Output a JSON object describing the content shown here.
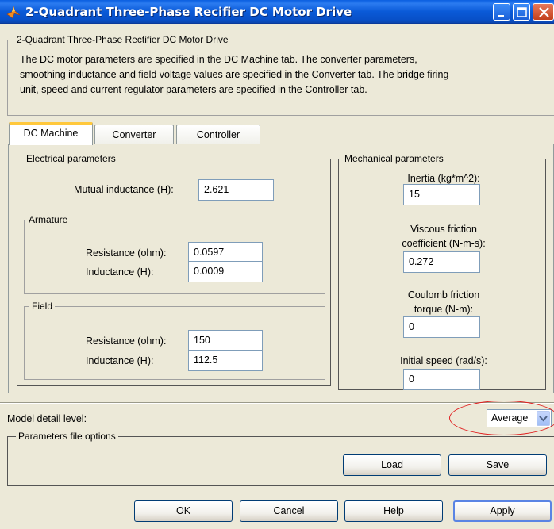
{
  "window": {
    "title": "2-Quadrant Three-Phase Recifier DC Motor Drive",
    "icon": "matlab-logo-icon"
  },
  "description": {
    "group_title": "2-Quadrant Three-Phase Rectifier DC Motor Drive",
    "lines": [
      "The DC motor parameters are specified in the DC Machine tab. The converter parameters,",
      "smoothing inductance and field voltage values are specified in the Converter tab. The bridge firing",
      "unit, speed and current regulator parameters are specified in the Controller tab."
    ]
  },
  "tabs": [
    {
      "label": "DC Machine",
      "active": true
    },
    {
      "label": "Converter",
      "active": false
    },
    {
      "label": "Controller",
      "active": false
    }
  ],
  "electrical": {
    "title": "Electrical parameters",
    "mutual_label": "Mutual inductance (H):",
    "mutual_value": "2.621",
    "armature": {
      "title": "Armature",
      "resistance_label": "Resistance (ohm):",
      "resistance_value": "0.0597",
      "inductance_label": "Inductance (H):",
      "inductance_value": "0.0009"
    },
    "field": {
      "title": "Field",
      "resistance_label": "Resistance (ohm):",
      "resistance_value": "150",
      "inductance_label": "Inductance (H):",
      "inductance_value": "112.5"
    }
  },
  "mechanical": {
    "title": "Mechanical parameters",
    "inertia_label": "Inertia (kg*m^2):",
    "inertia_value": "15",
    "viscous_label_1": "Viscous friction",
    "viscous_label_2": "coefficient (N-m-s):",
    "viscous_value": "0.272",
    "coulomb_label_1": "Coulomb friction",
    "coulomb_label_2": "torque (N-m):",
    "coulomb_value": "0",
    "speed_label": "Initial speed (rad/s):",
    "speed_value": "0"
  },
  "model_detail": {
    "label": "Model detail level:",
    "selected": "Average"
  },
  "params_file": {
    "title": "Parameters file options",
    "load_label": "Load",
    "save_label": "Save"
  },
  "footer": {
    "ok": "OK",
    "cancel": "Cancel",
    "help": "Help",
    "apply": "Apply"
  },
  "colors": {
    "titlebar": "#0a5ad8",
    "dialog_bg": "#ece9d8",
    "active_tab_accent": "#ffc83c",
    "highlight_ellipse": "#e02020"
  }
}
